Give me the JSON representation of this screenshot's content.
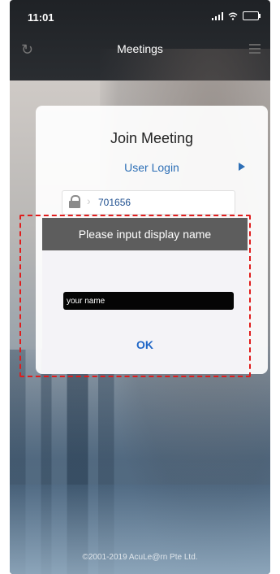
{
  "status_bar": {
    "time": "11:01"
  },
  "nav": {
    "title": "Meetings"
  },
  "join_card": {
    "title": "Join Meeting",
    "user_login_label": "User Login",
    "meeting_id": "701656"
  },
  "dialog": {
    "title": "Please input display name",
    "name_placeholder": "your name",
    "ok_label": "OK"
  },
  "footer": {
    "copyright": "©2001-2019 AcuLe@rn Pte Ltd."
  },
  "colors": {
    "accent_blue": "#2d6fb6",
    "ok_blue": "#1f66c7",
    "dialog_header": "#5d5d5d",
    "highlight_red": "#e01c1c"
  },
  "icons": [
    "refresh-icon",
    "menu-list-icon",
    "signal-icon",
    "wifi-icon",
    "battery-icon",
    "lock-icon",
    "play-arrow-icon"
  ]
}
